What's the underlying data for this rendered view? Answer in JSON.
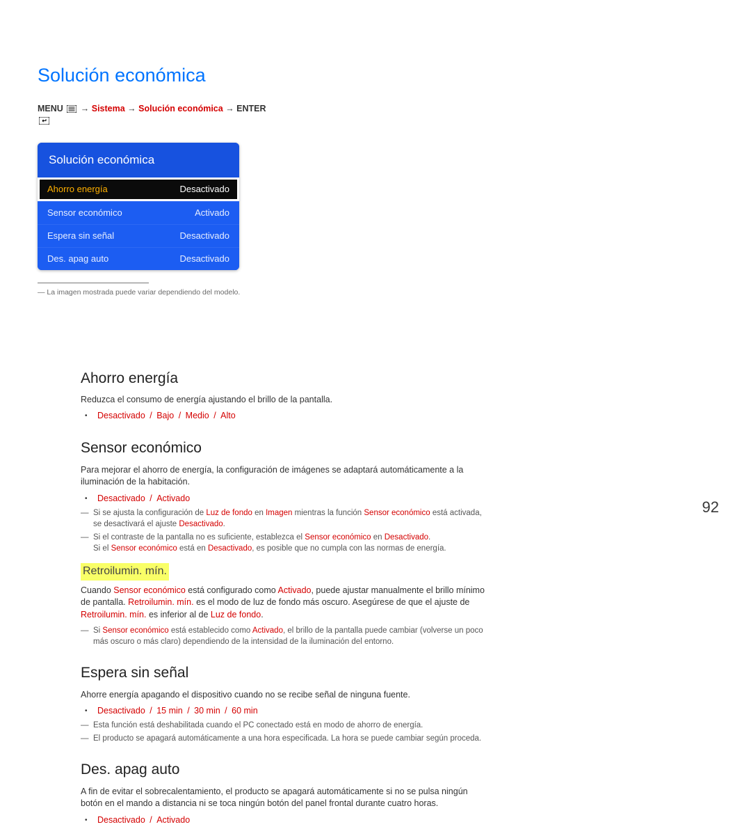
{
  "page_title": "Solución económica",
  "breadcrumb": {
    "menu": "MENU",
    "sistema": "Sistema",
    "solucion": "Solución económica",
    "enter": "ENTER"
  },
  "menu": {
    "title": "Solución económica",
    "items": [
      {
        "label": "Ahorro energía",
        "value": "Desactivado"
      },
      {
        "label": "Sensor económico",
        "value": "Activado"
      },
      {
        "label": "Espera sin señal",
        "value": "Desactivado"
      },
      {
        "label": "Des. apag auto",
        "value": "Desactivado"
      }
    ]
  },
  "menu_note": "La imagen mostrada puede variar dependiendo del modelo.",
  "sections": {
    "ahorro": {
      "title": "Ahorro energía",
      "desc": "Reduzca el consumo de energía ajustando el brillo de la pantalla.",
      "options": [
        "Desactivado",
        "Bajo",
        "Medio",
        "Alto"
      ]
    },
    "sensor": {
      "title": "Sensor económico",
      "desc": "Para mejorar el ahorro de energía, la configuración de imágenes se adaptará automáticamente a la iluminación de la habitación.",
      "options": [
        "Desactivado",
        "Activado"
      ],
      "note1_pre": "Si se ajusta la configuración de ",
      "note1_luz": "Luz de fondo",
      "note1_mid1": " en ",
      "note1_imagen": "Imagen",
      "note1_mid2": " mientras la función ",
      "note1_sensor": "Sensor económico",
      "note1_mid3": " está activada, se desactivará el ajuste ",
      "note1_des": "Desactivado",
      "note1_end": ".",
      "note2_pre": "Si el contraste de la pantalla no es suficiente, establezca el ",
      "note2_sensor": "Sensor económico",
      "note2_mid": " en ",
      "note2_val": "Desactivado",
      "note2_end": ".",
      "note2b_pre": "Si el ",
      "note2b_sensor": "Sensor económico",
      "note2b_mid": " está en ",
      "note2b_val": "Desactivado",
      "note2b_end": ", es posible que no cumpla con las normas de energía."
    },
    "retro": {
      "title": "Retroilumin. mín.",
      "p1_pre": "Cuando ",
      "p1_sensor": "Sensor económico",
      "p1_mid1": " está configurado como ",
      "p1_act": "Activado",
      "p1_mid2": ", puede ajustar manualmente el brillo mínimo de pantalla. ",
      "p1_retro": "Retroilumin. mín.",
      "p1_mid3": " es el modo de luz de fondo más oscuro. Asegúrese de que el ajuste de ",
      "p1_retro2": "Retroilumin. mín.",
      "p1_mid4": " es inferior al de ",
      "p1_luz": "Luz de fondo",
      "p1_end": ".",
      "n1_pre": "Si ",
      "n1_sensor": "Sensor económico",
      "n1_mid1": " está establecido como ",
      "n1_act": "Activado",
      "n1_end": ", el brillo de la pantalla puede cambiar (volverse un poco más oscuro o más claro) dependiendo de la intensidad de la iluminación del entorno."
    },
    "espera": {
      "title": "Espera sin señal",
      "desc": "Ahorre energía apagando el dispositivo cuando no se recibe señal de ninguna fuente.",
      "options": [
        "Desactivado",
        "15 min",
        "30 min",
        "60 min"
      ],
      "note1": "Esta función está deshabilitada cuando el PC conectado está en modo de ahorro de energía.",
      "note2": "El producto se apagará automáticamente a una hora especificada. La hora se puede cambiar según proceda."
    },
    "apag": {
      "title": "Des. apag auto",
      "desc": "A fin de evitar el sobrecalentamiento, el producto se apagará automáticamente si no se pulsa ningún botón en el mando a distancia ni se toca ningún botón del panel frontal durante cuatro horas.",
      "options": [
        "Desactivado",
        "Activado"
      ]
    }
  },
  "page_number": "92"
}
